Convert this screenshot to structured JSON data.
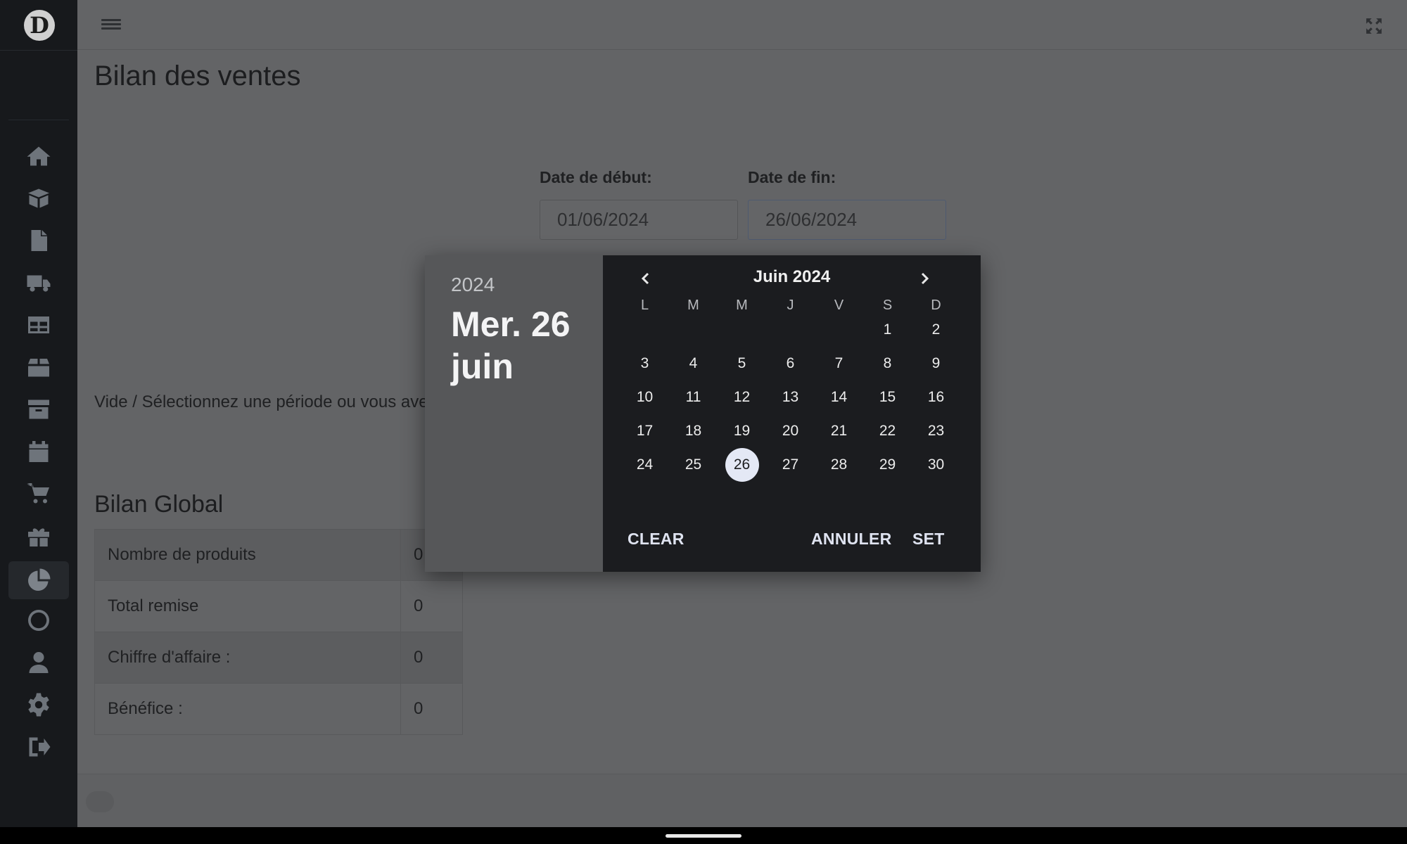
{
  "sidebar": {
    "logo_letter": "D",
    "items": [
      {
        "icon": "home-icon",
        "active": false
      },
      {
        "icon": "box-open-icon",
        "active": false
      },
      {
        "icon": "file-icon",
        "active": false
      },
      {
        "icon": "truck-icon",
        "active": false
      },
      {
        "icon": "table-icon",
        "active": false
      },
      {
        "icon": "box-icon",
        "active": false
      },
      {
        "icon": "archive-icon",
        "active": false
      },
      {
        "icon": "calendar-icon",
        "active": false
      },
      {
        "icon": "cart-icon",
        "active": false
      },
      {
        "icon": "gift-icon",
        "active": false
      },
      {
        "icon": "pie-chart-icon",
        "active": true
      },
      {
        "icon": "circle-icon",
        "active": false
      },
      {
        "icon": "user-icon",
        "active": false
      },
      {
        "icon": "gear-icon",
        "active": false
      },
      {
        "icon": "sign-out-icon",
        "active": false
      }
    ]
  },
  "page": {
    "title": "Bilan des ventes",
    "start_label": "Date de début:",
    "start_value": "01/06/2024",
    "end_label": "Date de fin:",
    "end_value": "26/06/2024",
    "empty_message": "Vide / Sélectionnez une période ou vous ave"
  },
  "summary": {
    "title": "Bilan Global",
    "rows": [
      {
        "label": "Nombre de produits",
        "value": "0"
      },
      {
        "label": "Total remise",
        "value": "0"
      },
      {
        "label": "Chiffre d'affaire :",
        "value": "0"
      },
      {
        "label": "Bénéfice :",
        "value": "0"
      }
    ]
  },
  "picker": {
    "year": "2024",
    "selected_date": "Mer. 26 juin",
    "month_label": "Juin 2024",
    "weekdays": [
      "L",
      "M",
      "M",
      "J",
      "V",
      "S",
      "D"
    ],
    "leading_blanks": 5,
    "days_in_month": 30,
    "selected_day": 26,
    "clear_label": "CLEAR",
    "cancel_label": "ANNULER",
    "set_label": "SET"
  },
  "colors": {
    "sidebar_bg": "#17191c",
    "calendar_bg": "#1b1c1f",
    "selected_day_bg": "#e4e8f5",
    "action_text": "#dfe3f0"
  }
}
